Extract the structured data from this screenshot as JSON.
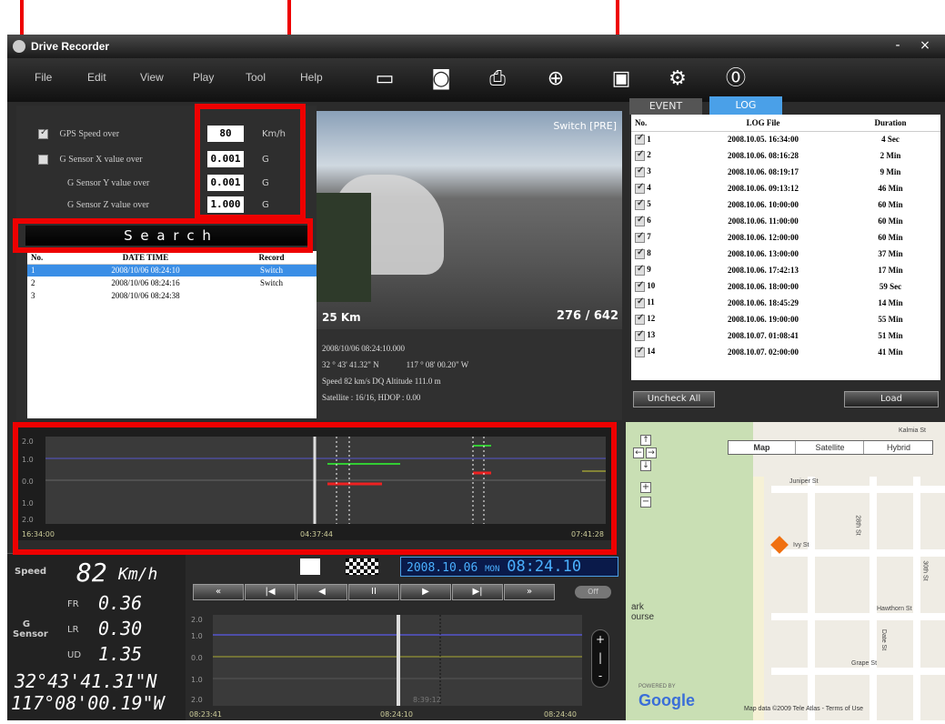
{
  "window": {
    "title": "Drive Recorder",
    "minimize": "-",
    "close": "×"
  },
  "menu": [
    "File",
    "Edit",
    "View",
    "Play",
    "Tool",
    "Help"
  ],
  "toolbar_icons": [
    "folder-icon",
    "camera-icon",
    "print-icon",
    "zoom-icon",
    "save-icon",
    "settings-icon",
    "help-icon"
  ],
  "filters": {
    "gps_speed_label": "GPS Speed over",
    "gps_speed_value": "80",
    "gps_speed_unit": "Km/h",
    "gx_label": "G Sensor X value over",
    "gx_value": "0.001",
    "gx_unit": "G",
    "gy_label": "G Sensor Y value over",
    "gy_value": "0.001",
    "gy_unit": "G",
    "gz_label": "G Sensor Z value over",
    "gz_value": "1.000",
    "gz_unit": "G"
  },
  "search_label": "S e a r c h",
  "results": {
    "headers": [
      "No.",
      "DATE TIME",
      "Record"
    ],
    "rows": [
      [
        "1",
        "2008/10/06 08:24:10",
        "Switch"
      ],
      [
        "2",
        "2008/10/06 08:24:16",
        "Switch"
      ],
      [
        "3",
        "2008/10/06 08:24:38",
        ""
      ]
    ]
  },
  "video": {
    "overlay_top": "Switch [PRE]",
    "overlay_speed": "25 Km",
    "overlay_frame": "276 / 642",
    "info_datetime": "2008/10/06 08:24:10.000",
    "info_lat": "32 ° 43' 41.32\" N",
    "info_lon": "117 ° 08' 00.20\" W",
    "info_speed": "Speed  82 km/s  DQ  Altitude 111.0 m",
    "info_sat": "Satellite : 16/16,  HDOP : 0.00"
  },
  "tabs": {
    "event": "EVENT",
    "log": "LOG"
  },
  "log": {
    "headers": [
      "No.",
      "LOG File",
      "Duration"
    ],
    "rows": [
      [
        "1",
        "2008.10.05. 16:34:00",
        "4 Sec"
      ],
      [
        "2",
        "2008.10.06. 08:16:28",
        "2 Min"
      ],
      [
        "3",
        "2008.10.06. 08:19:17",
        "9 Min"
      ],
      [
        "4",
        "2008.10.06. 09:13:12",
        "46 Min"
      ],
      [
        "5",
        "2008.10.06. 10:00:00",
        "60 Min"
      ],
      [
        "6",
        "2008.10.06. 11:00:00",
        "60 Min"
      ],
      [
        "7",
        "2008.10.06. 12:00:00",
        "60 Min"
      ],
      [
        "8",
        "2008.10.06. 13:00:00",
        "37 Min"
      ],
      [
        "9",
        "2008.10.06. 17:42:13",
        "17 Min"
      ],
      [
        "10",
        "2008.10.06. 18:00:00",
        "59 Sec"
      ],
      [
        "11",
        "2008.10.06. 18:45:29",
        "14 Min"
      ],
      [
        "12",
        "2008.10.06. 19:00:00",
        "55 Min"
      ],
      [
        "13",
        "2008.10.07. 01:08:41",
        "51 Min"
      ],
      [
        "14",
        "2008.10.07. 02:00:00",
        "41 Min"
      ]
    ],
    "uncheck_all": "Uncheck All",
    "load": "Load"
  },
  "graph_top": {
    "y_ticks": [
      "2.0",
      "1.0",
      "0.0",
      "1.0",
      "2.0"
    ],
    "x_start": "16:34:00",
    "x_mid": "04:37:44",
    "x_end": "07:41:28"
  },
  "gauges": {
    "speed_label": "Speed",
    "speed_value": "82",
    "speed_unit": "Km/h",
    "g_label": "G\nSensor",
    "fr_label": "FR",
    "fr_value": "0.36",
    "lr_label": "LR",
    "lr_value": "0.30",
    "ud_label": "UD",
    "ud_value": "1.35",
    "lat": "32°43'41.31\"N",
    "lon": "117°08'00.19\"W"
  },
  "clock": {
    "date": "2008.10.06",
    "day": "MON",
    "time": "08:24.10"
  },
  "player_buttons": [
    "«",
    "|◀",
    "◀",
    "II",
    "▶",
    "▶|",
    "»"
  ],
  "player_toggle": "Off",
  "graph_bottom": {
    "y_ticks": [
      "2.0",
      "1.0",
      "0.0",
      "1.0",
      "2.0"
    ],
    "x_start": "08:23:41",
    "x_mid": "08:24:10",
    "x_end": "08:24:40",
    "cursor_label": "8:39:12"
  },
  "map": {
    "type_buttons": [
      "Map",
      "Satellite",
      "Hybrid"
    ],
    "streets": [
      "Juniper St",
      "Ivy St",
      "Hawthorn St",
      "Grape St",
      "28th St",
      "30th St",
      "Date St",
      "Kalmia St"
    ],
    "park_label": "ark\nourse",
    "logo": "Google",
    "powered": "POWERED BY",
    "attribution": "Map data ©2009 Tele Atlas - Terms of Use"
  }
}
